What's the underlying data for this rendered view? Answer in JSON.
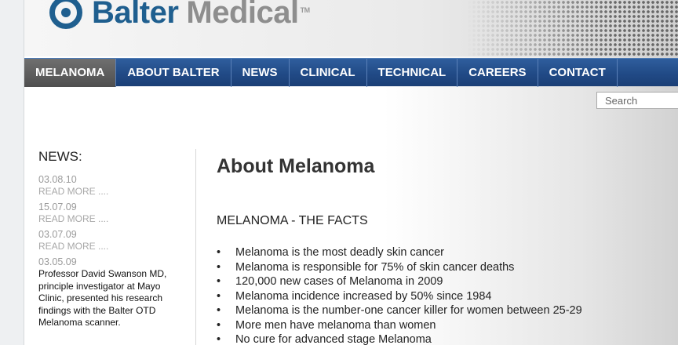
{
  "brand": {
    "part1": "Balter",
    "part2": "Medical",
    "tm": "TM",
    "color": "#1f5f8f"
  },
  "nav": {
    "items": [
      {
        "label": "MELANOMA",
        "active": true
      },
      {
        "label": "ABOUT BALTER"
      },
      {
        "label": "NEWS"
      },
      {
        "label": "CLINICAL"
      },
      {
        "label": "TECHNICAL"
      },
      {
        "label": "CAREERS"
      },
      {
        "label": "CONTACT"
      }
    ]
  },
  "search": {
    "placeholder": "Search"
  },
  "sidebar": {
    "title": "NEWS:",
    "items": [
      {
        "date": "03.08.10",
        "more": "READ MORE ...."
      },
      {
        "date": "15.07.09",
        "more": "READ MORE ...."
      },
      {
        "date": "03.07.09",
        "more": "READ MORE ...."
      },
      {
        "date": "03.05.09",
        "summary": "Professor David Swanson MD, principle investigator at Mayo Clinic, presented his research findings with the Balter OTD Melanoma scanner."
      }
    ]
  },
  "main": {
    "title": "About Melanoma",
    "facts_heading": "MELANOMA - THE FACTS",
    "facts": [
      "Melanoma is the most deadly skin cancer",
      "Melanoma is responsible for 75% of skin cancer deaths",
      "120,000 new cases of Melanoma in 2009",
      "Melanoma incidence increased by 50% since 1984",
      "Melanoma is the number-one cancer killer for women between 25-29",
      "More men have melanoma than women",
      "No cure for advanced stage Melanoma"
    ]
  }
}
